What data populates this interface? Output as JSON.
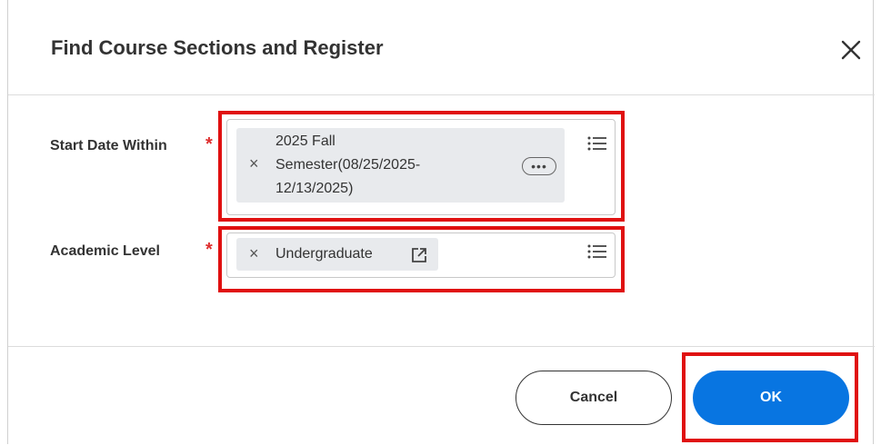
{
  "dialog": {
    "title": "Find Course Sections and Register",
    "close_icon": "close-icon"
  },
  "fields": {
    "start_date": {
      "label": "Start Date Within",
      "required_mark": "*",
      "selected": {
        "line1": "2025 Fall",
        "line2": "Semester(08/25/2025-",
        "line3": "12/13/2025)"
      },
      "remove_symbol": "×",
      "more_symbol": "•••",
      "list_icon": "list-icon"
    },
    "academic_level": {
      "label": "Academic Level",
      "required_mark": "*",
      "selected": "Undergraduate",
      "remove_symbol": "×",
      "external_link_icon": "external-link-icon",
      "list_icon": "list-icon"
    }
  },
  "footer": {
    "cancel_label": "Cancel",
    "ok_label": "OK"
  },
  "colors": {
    "primary": "#0875e1",
    "required": "#de2f2f",
    "highlight": "#e01010"
  }
}
